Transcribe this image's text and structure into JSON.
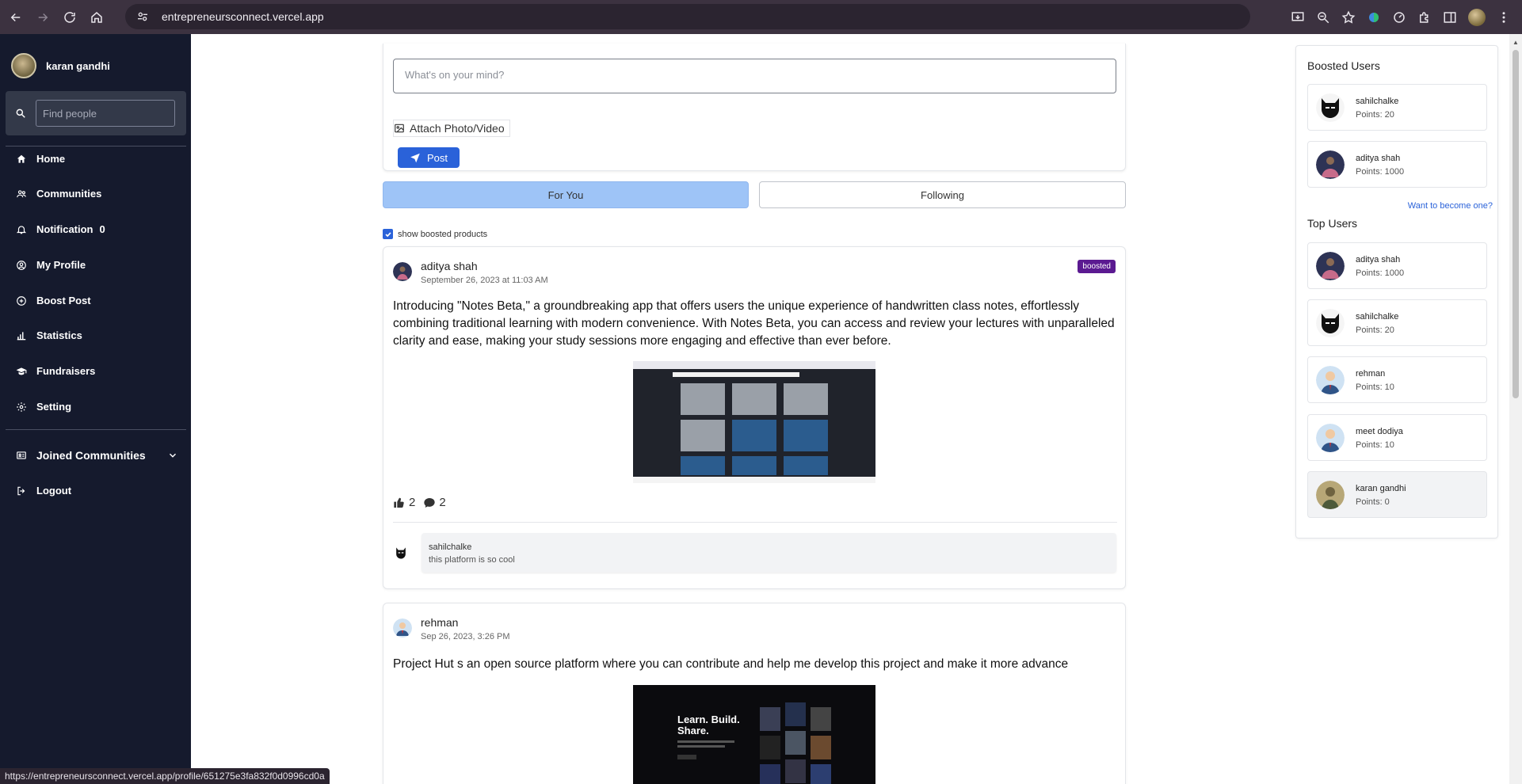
{
  "browser": {
    "url": "entrepreneursconnect.vercel.app",
    "status_url": "https://entrepreneursconnect.vercel.app/profile/651275e3fa832f0d0996cd0a"
  },
  "sidebar": {
    "user_name": "karan gandhi",
    "search_placeholder": "Find people",
    "items": [
      {
        "label": "Home",
        "icon": "home-icon"
      },
      {
        "label": "Communities",
        "icon": "users-icon"
      },
      {
        "label": "Notification",
        "icon": "bell-icon",
        "count": "0"
      },
      {
        "label": "My Profile",
        "icon": "user-circle-icon"
      },
      {
        "label": "Boost Post",
        "icon": "plus-circle-icon"
      },
      {
        "label": "Statistics",
        "icon": "bar-chart-icon"
      },
      {
        "label": "Fundraisers",
        "icon": "graduation-cap-icon"
      },
      {
        "label": "Setting",
        "icon": "gear-icon"
      }
    ],
    "joined_communities": "Joined Communities",
    "logout": "Logout"
  },
  "composer": {
    "placeholder": "What's on your mind?",
    "attach_label": "Attach Photo/Video",
    "post_label": "Post"
  },
  "tabs": {
    "for_you": "For You",
    "following": "Following"
  },
  "show_boosted_label": "show boosted products",
  "posts": [
    {
      "author": "aditya shah",
      "time": "September 26, 2023 at 11:03 AM",
      "badge": "boosted",
      "body": "Introducing \"Notes Beta,\" a groundbreaking app that offers users the unique experience of handwritten class notes, effortlessly combining traditional learning with modern convenience. With Notes Beta, you can access and review your lectures with unparalleled clarity and ease, making your study sessions more engaging and effective than ever before.",
      "likes": "2",
      "comments": "2",
      "comment": {
        "author": "sahilchalke",
        "text": "this platform is so cool"
      }
    },
    {
      "author": "rehman",
      "time": "Sep 26, 2023, 3:26 PM",
      "body": "Project Hut s an open source platform where you can contribute and help me develop this project and make it more advance",
      "image_headline_1": "Learn. Build.",
      "image_headline_2": "Share."
    }
  ],
  "right_panel": {
    "boosted_title": "Boosted Users",
    "boosted_users": [
      {
        "name": "sahilchalke",
        "points": "Points: 20"
      },
      {
        "name": "aditya shah",
        "points": "Points: 1000"
      }
    ],
    "want_link": "Want to become one?",
    "top_title": "Top Users",
    "top_users": [
      {
        "name": "aditya shah",
        "points": "Points: 1000"
      },
      {
        "name": "sahilchalke",
        "points": "Points: 20"
      },
      {
        "name": "rehman",
        "points": "Points: 10"
      },
      {
        "name": "meet dodiya",
        "points": "Points: 10"
      },
      {
        "name": "karan gandhi",
        "points": "Points: 0"
      }
    ]
  },
  "colors": {
    "sidebar_bg": "#151a2d",
    "accent": "#2a62d9",
    "tab_active": "#9ec4f7",
    "badge": "#5b1a91"
  }
}
